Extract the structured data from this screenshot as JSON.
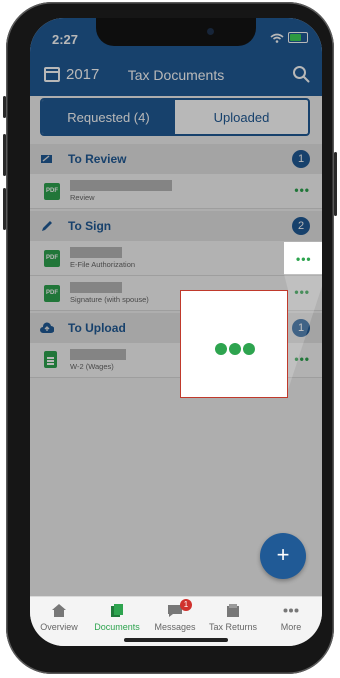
{
  "status": {
    "time": "2:27"
  },
  "header": {
    "year": "2017",
    "title": "Tax Documents",
    "search_icon": "search-icon"
  },
  "tabs": [
    {
      "label": "Requested (4)",
      "active": true
    },
    {
      "label": "Uploaded",
      "active": false
    }
  ],
  "sections": [
    {
      "label": "To Review",
      "count": "1",
      "icon": "review-icon",
      "items": [
        {
          "type_icon": "pdf-icon",
          "badge": "PDF",
          "subtitle": "Review",
          "menu": "•••"
        }
      ]
    },
    {
      "label": "To Sign",
      "count": "2",
      "icon": "pencil-icon",
      "items": [
        {
          "type_icon": "pdf-icon",
          "badge": "PDF",
          "subtitle": "E-File Authorization",
          "menu": "•••"
        },
        {
          "type_icon": "pdf-icon",
          "badge": "PDF",
          "subtitle": "Signature (with spouse)",
          "menu": "•••"
        }
      ]
    },
    {
      "label": "To Upload",
      "count": "1",
      "icon": "cloud-upload-icon",
      "items": [
        {
          "type_icon": "document-icon",
          "subtitle": "W-2 (Wages)",
          "menu": "•••"
        }
      ]
    }
  ],
  "callout": {
    "highlight": "•••"
  },
  "fab": {
    "label": "+"
  },
  "nav": [
    {
      "label": "Overview",
      "icon": "home-icon",
      "active": false
    },
    {
      "label": "Documents",
      "icon": "documents-icon",
      "active": true
    },
    {
      "label": "Messages",
      "icon": "messages-icon",
      "active": false,
      "badge": "1"
    },
    {
      "label": "Tax Returns",
      "icon": "tax-returns-icon",
      "active": false
    },
    {
      "label": "More",
      "icon": "more-icon",
      "active": false
    }
  ],
  "colors": {
    "brand": "#205a96",
    "accent_green": "#2ea44f",
    "badge_red": "#d0312d"
  }
}
